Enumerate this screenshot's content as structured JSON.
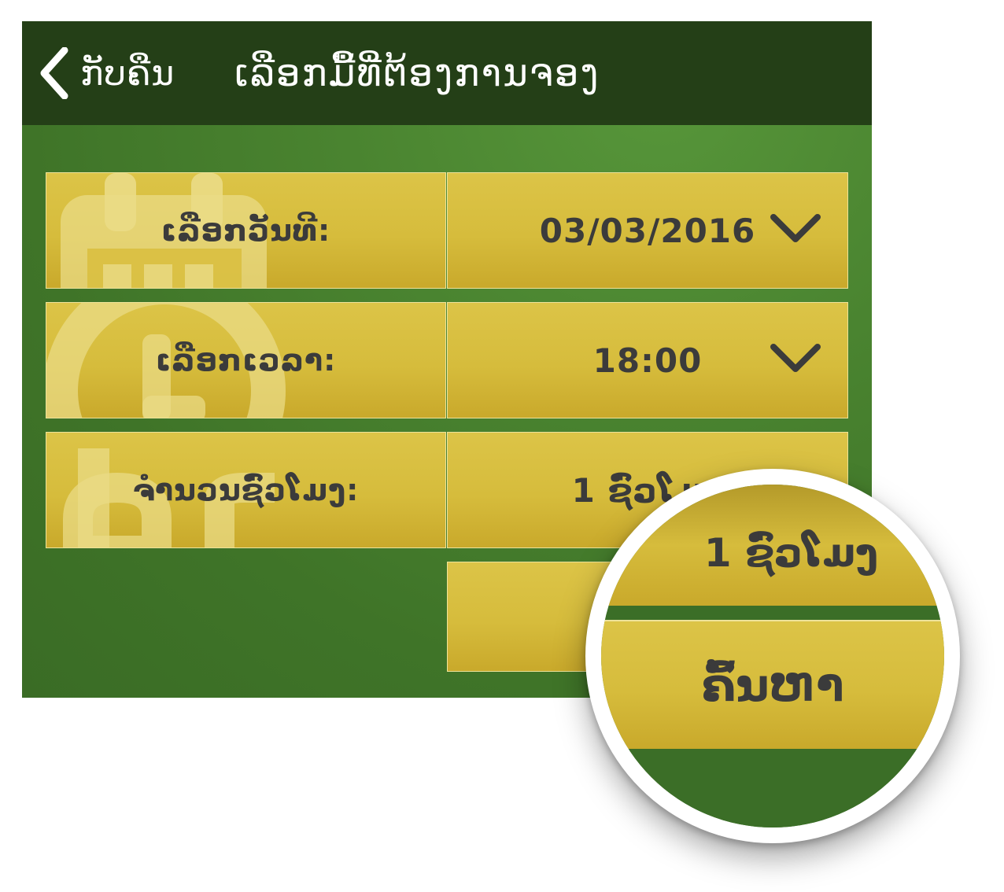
{
  "header": {
    "back_label": "ກັບຄືນ",
    "title": "ເລືອກມື້ທີ່ຕ້ອງການຈອງ"
  },
  "form": {
    "date": {
      "label": "ເລືອກວັນທີ:",
      "value": "03/03/2016",
      "icon": "calendar-icon"
    },
    "time": {
      "label": "ເລືອກເວລາ:",
      "value": "18:00",
      "icon": "clock-icon"
    },
    "hours": {
      "label": "ຈຳນວນຊົ່ວໂມງ:",
      "value": "1 ຊົ່ວໂມງ",
      "icon": "hr-icon"
    },
    "search_label": "ຄົ້ນຫາ"
  },
  "zoom": {
    "value": "1 ຊົ່ວໂມງ",
    "search_label": "ຄົ້ນຫາ"
  },
  "colors": {
    "header_bg": "#243f17",
    "screen_bg": "#4a8430",
    "button_gold": "#d6bc3c",
    "text_dark": "#3b3b3b"
  }
}
